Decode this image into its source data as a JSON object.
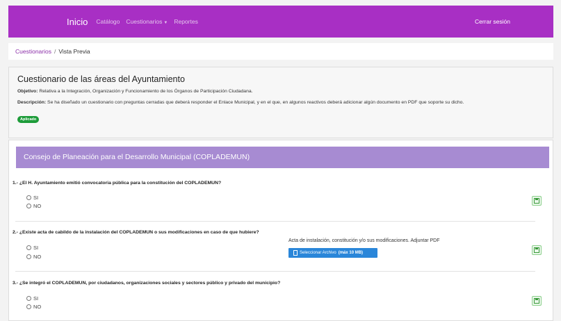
{
  "nav": {
    "brand": "Inicio",
    "links": [
      "Catálogo",
      "Cuestionarios",
      "Reportes"
    ],
    "logout": "Cerrar sesión"
  },
  "breadcrumb": {
    "parent": "Cuestionarios",
    "separator": "/",
    "current": "Vista Previa"
  },
  "header": {
    "title": "Cuestionario de las áreas del Ayuntamiento",
    "objective_label": "Objetivo:",
    "objective_text": " Relativa a la Integración, Organización y Funcionamiento de los Órganos de Participación Ciudadana.",
    "description_label": "Descripción:",
    "description_text": " Se ha diseñado un cuestionario con preguntas cerradas que deberá responder el Enlace Municipal, y en el que, en algunos reactivos deberá adicionar algún documento en PDF que soporte su dicho.",
    "status_badge": "Aplicado"
  },
  "section": {
    "title": "Consejo de Planeación para el Desarrollo Municipal (COPLADEMUN)",
    "questions": [
      {
        "title": "1.- ¿El H. Ayuntamiento emitió convocatoria pública para la constitución del COPLADEMUN?",
        "options": [
          "SI",
          "NO"
        ]
      },
      {
        "title": "2.- ¿Existe acta de cabildo de la instalación del COPLADEMUN o sus modificaciones en caso de que hubiere?",
        "options": [
          "SI",
          "NO"
        ],
        "attachment_label": "Acta de instalación, constitución y/o sus modificaciones. Adjuntar PDF",
        "file_button": "Seleccionar Archivo",
        "file_limit": "(máx 10 MB)"
      },
      {
        "title": "3.- ¿Se integró el COPLADEMUN, por ciudadanos, organizaciones sociales y sectores público y privado del municipio?",
        "options": [
          "SI",
          "NO"
        ]
      }
    ]
  },
  "colors": {
    "navbar": "#a82fc4",
    "section_header": "#a78bd2",
    "badge": "#1e9c3a",
    "file_button": "#2a86d9"
  },
  "icons": {
    "save": "save-icon",
    "file": "file-icon",
    "caret": "caret-down-icon"
  }
}
